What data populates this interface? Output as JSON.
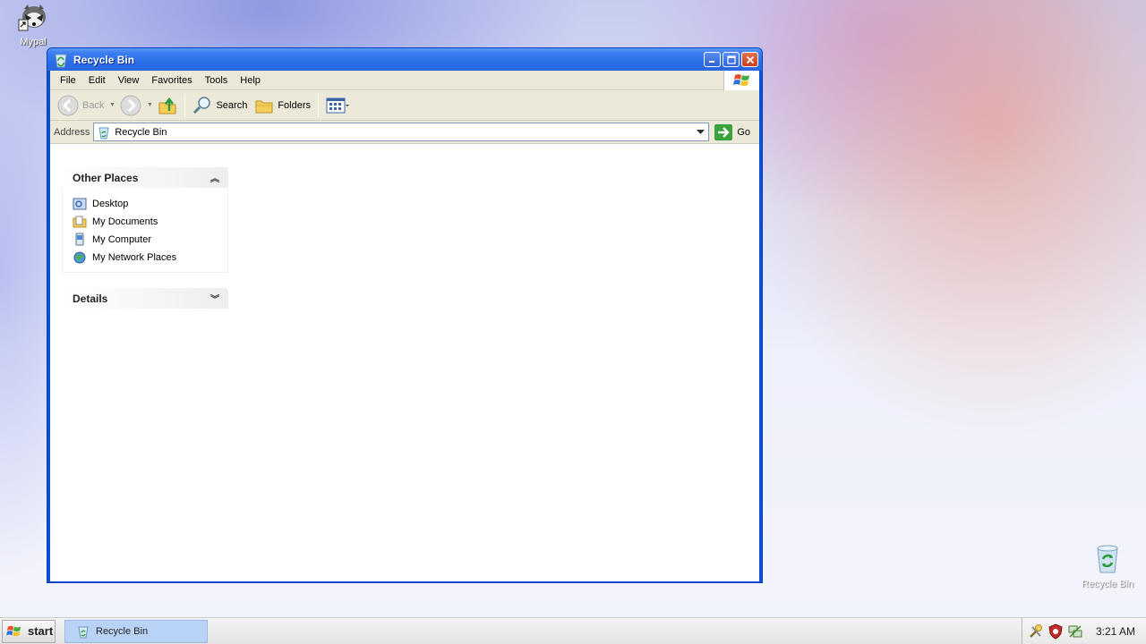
{
  "desktop": {
    "icons": [
      {
        "label": "Mypal",
        "icon": "mypal-raccoon-icon"
      },
      {
        "label": "Recycle Bin",
        "icon": "recycle-bin-icon"
      }
    ]
  },
  "window": {
    "title": "Recycle Bin",
    "menu": [
      "File",
      "Edit",
      "View",
      "Favorites",
      "Tools",
      "Help"
    ],
    "toolbar": {
      "back_label": "Back",
      "search_label": "Search",
      "folders_label": "Folders"
    },
    "address": {
      "label": "Address",
      "value": "Recycle Bin",
      "go_label": "Go"
    },
    "panels": {
      "other_places": {
        "title": "Other Places",
        "items": [
          "Desktop",
          "My Documents",
          "My Computer",
          "My Network Places"
        ]
      },
      "details": {
        "title": "Details"
      }
    }
  },
  "taskbar": {
    "start_label": "start",
    "task_label": "Recycle Bin",
    "clock": "3:21 AM"
  },
  "colors": {
    "title_blue": "#2a6fe8",
    "taskbar_active": "#b9d3f6",
    "chrome": "#ece9d8"
  }
}
